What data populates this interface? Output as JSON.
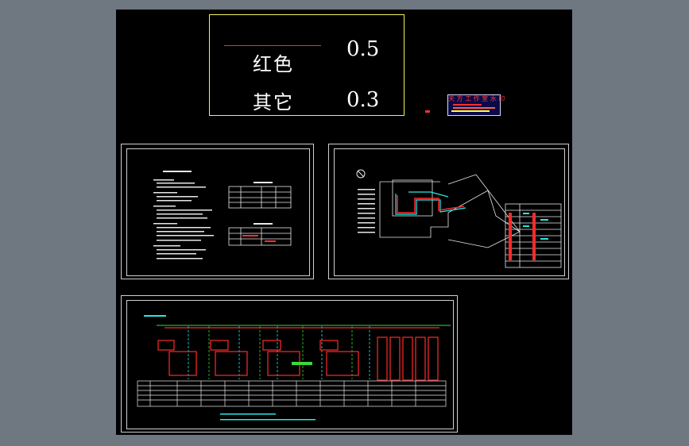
{
  "legend": {
    "row1": {
      "name": "红色",
      "value": "0.5",
      "line_color": "#ff2a2a"
    },
    "row2": {
      "name": "其它",
      "value": "0.3"
    }
  },
  "stamp": {
    "title": "天 方 工 作 室 水 印"
  },
  "colors": {
    "background": "#6f7780",
    "canvas": "#000000",
    "frame": "#d0d0d0",
    "legend_border": "#f2f25a",
    "cad_red": "#ff2a2a",
    "cad_cyan": "#2ae6e6",
    "cad_green": "#3ad83a",
    "cad_yellow": "#f2f25a"
  }
}
